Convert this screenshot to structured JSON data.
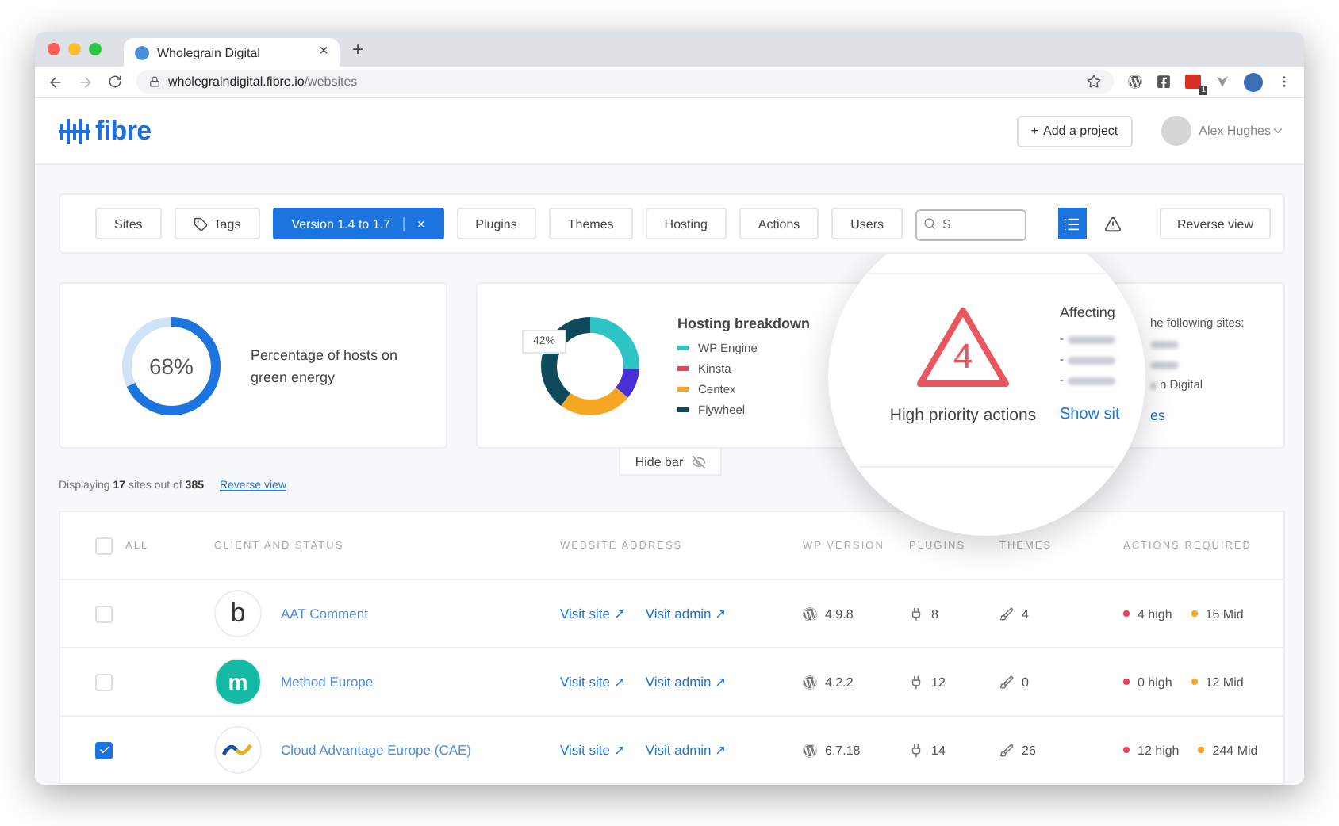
{
  "browser": {
    "tab_title": "Wholegrain Digital",
    "close_tab": "×",
    "new_tab": "+",
    "url_host": "wholegraindigital.fibre.io",
    "url_path": "/websites",
    "extension_badge": "1"
  },
  "header": {
    "logo": "fibre",
    "add_icon": "+",
    "add_project": "Add a project",
    "user": "Alex Hughes"
  },
  "filters": [
    {
      "label": "Sites",
      "kind": "plain",
      "selected": false
    },
    {
      "label": "Tags",
      "kind": "tag",
      "selected": false
    },
    {
      "label": "Version 1.4 to 1.7",
      "kind": "plain",
      "selected": true,
      "clear": "×"
    },
    {
      "label": "Plugins",
      "kind": "plain",
      "selected": false
    },
    {
      "label": "Themes",
      "kind": "plain",
      "selected": false
    },
    {
      "label": "Hosting",
      "kind": "plain",
      "selected": false
    },
    {
      "label": "Actions",
      "kind": "plain",
      "selected": false
    },
    {
      "label": "Users",
      "kind": "plain",
      "selected": false
    }
  ],
  "search": {
    "placeholder": "S"
  },
  "view_modes": [
    {
      "kind": "list",
      "selected": true
    },
    {
      "kind": "warning",
      "selected": false
    }
  ],
  "reverse_view_button": "Reverse view",
  "green_energy": {
    "value": "68%",
    "level": 0.68,
    "label": "Percentage of hosts on green energy"
  },
  "hosting": {
    "title": "Hosting breakdown",
    "callout": "42%",
    "legend": [
      {
        "name": "WP Engine",
        "color": "#2ec4c6"
      },
      {
        "name": "Kinsta",
        "color": "#e8445a"
      },
      {
        "name": "Centex",
        "color": "#f5a623"
      },
      {
        "name": "Flywheel",
        "color": "#0f4a5c"
      }
    ]
  },
  "actions": {
    "count": "4",
    "label": "High priority actions",
    "affecting": "Affecting",
    "affecting_rest": "he following sites:",
    "sites": [
      {
        "bullet": "-"
      },
      {
        "bullet": "-"
      },
      {
        "bullet": "-",
        "tail": "n Digital"
      }
    ],
    "show_sites": "Show sit",
    "show_sites_rest": "es"
  },
  "hide_bar": "Hide bar",
  "summary": {
    "text": "Displaying **17** sites out of **385**",
    "link": "Reverse view"
  },
  "table": {
    "select_all": false,
    "select_all_label": "ALL",
    "columns": [
      "CLIENT AND STATUS",
      "WEBSITE ADDRESS",
      "WP VERSION",
      "PLUGINS",
      "THEMES",
      "ACTIONS REQUIRED"
    ],
    "rows": [
      {
        "checked": false,
        "logo": {
          "kind": "letter",
          "text": "b"
        },
        "name": "AAT Comment",
        "visit_site": "Visit site ↗",
        "visit_admin": "Visit admin ↗",
        "wp_version": "4.9.8",
        "plugins": "8",
        "themes": "4",
        "high": "4 high",
        "mid": "16 Mid"
      },
      {
        "checked": false,
        "logo": {
          "kind": "badge",
          "text": "m"
        },
        "name": "Method Europe",
        "visit_site": "Visit site ↗",
        "visit_admin": "Visit admin ↗",
        "wp_version": "4.2.2",
        "plugins": "12",
        "themes": "0",
        "high": "0 high",
        "mid": "12 Mid"
      },
      {
        "checked": true,
        "logo": {
          "kind": "wave"
        },
        "name": "Cloud Advantage Europe (CAE)",
        "visit_site": "Visit site ↗",
        "visit_admin": "Visit admin ↗",
        "wp_version": "6.7.18",
        "plugins": "14",
        "themes": "26",
        "high": "12 high",
        "mid": "244 Mid"
      }
    ]
  }
}
